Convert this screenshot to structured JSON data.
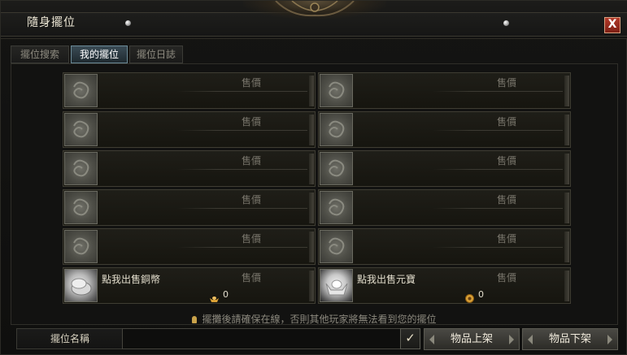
{
  "window": {
    "title": "隨身擺位",
    "close_label": "X"
  },
  "tabs": [
    {
      "label": "擺位搜索",
      "active": false
    },
    {
      "label": "我的擺位",
      "active": true
    },
    {
      "label": "擺位日誌",
      "active": false
    }
  ],
  "slots": {
    "price_label": "售價",
    "sell_copper": {
      "label": "點我出售銅幣",
      "amount": "0"
    },
    "sell_gold": {
      "label": "點我出售元寶",
      "amount": "0"
    }
  },
  "notice": "擺攤後請確保在線，否則其他玩家將無法看到您的擺位",
  "bottom": {
    "shop_name_label": "擺位名稱",
    "shop_name_value": "",
    "list_button": "物品上架",
    "unlist_button": "物品下架"
  },
  "colors": {
    "active_tab": "#3a4b55",
    "close_button": "#9b2b1f",
    "gold_coin": "#d9a036"
  }
}
